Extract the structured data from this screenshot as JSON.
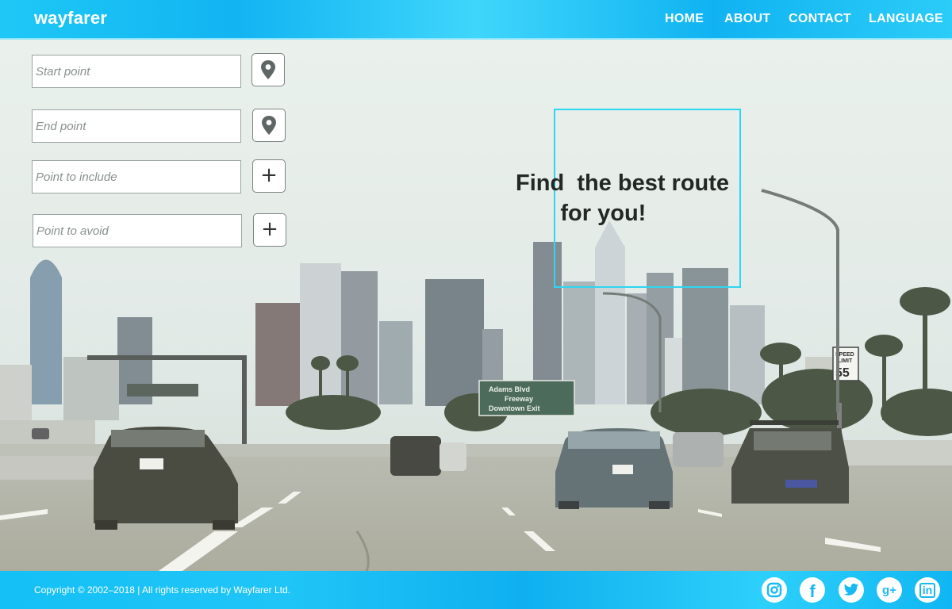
{
  "header": {
    "logo": "wayfarer",
    "nav": [
      "HOME",
      "ABOUT",
      "CONTACT",
      "LANGUAGE"
    ]
  },
  "form": {
    "start_placeholder": "Start point",
    "end_placeholder": "End point",
    "include_placeholder": "Point to include",
    "avoid_placeholder": "Point to avoid",
    "add_symbol": "+"
  },
  "hero": {
    "headline": "Find  the best route\n       for you!"
  },
  "scene": {
    "road_sign": [
      "Adams Blvd",
      "Freeway",
      "Downtown Exit"
    ],
    "speed_sign": [
      "SPEED",
      "LIMIT",
      "55"
    ]
  },
  "footer": {
    "copyright": "Copyright © 2002–2018 | All rights reserved by Wayfarer Ltd.",
    "social": [
      {
        "icon": "instagram-icon",
        "glyph": "◎"
      },
      {
        "icon": "facebook-icon",
        "glyph": "f"
      },
      {
        "icon": "twitter-icon",
        "glyph": "t"
      },
      {
        "icon": "google-plus-icon",
        "glyph": "g+"
      },
      {
        "icon": "linkedin-icon",
        "glyph": "in"
      }
    ]
  },
  "colors": {
    "header": "#14b8f3",
    "hero_box": "#2ed6f2",
    "text": "#232826"
  }
}
